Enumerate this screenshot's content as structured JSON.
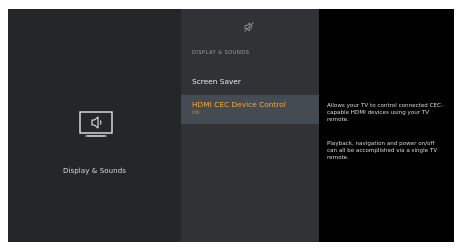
{
  "category": {
    "title": "Display & Sounds",
    "icon": "tv-speaker-icon"
  },
  "menu": {
    "top_icon": "volume-mute-icon",
    "section_header": "DISPLAY & SOUNDS",
    "items": [
      {
        "label": "Screen Saver"
      },
      {
        "label": "HDMI CEC Device Control",
        "value": "ON",
        "selected": true
      }
    ]
  },
  "description": {
    "paragraph1": "Allows your TV to control connected CEC-capable HDMI devices using your TV remote.",
    "paragraph2": "Playback, navigation and power on/off can all be accomplished via a single TV remote."
  },
  "colors": {
    "background": "#252627",
    "menu_panel": "#303235",
    "selected_row": "#454b52",
    "accent": "#f2a637",
    "description_panel": "#000000"
  }
}
